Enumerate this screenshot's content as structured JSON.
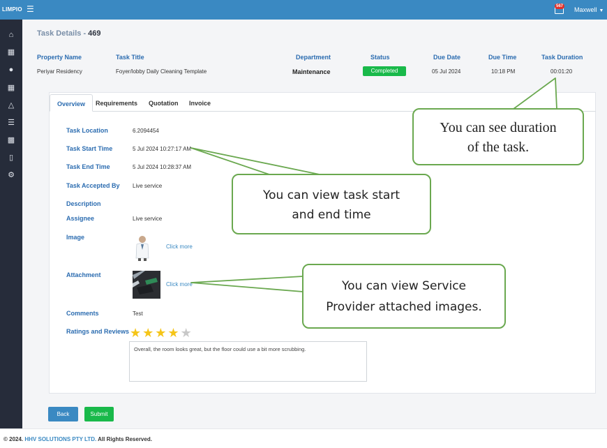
{
  "app": {
    "brand": "LIMPIO",
    "notification_count": "567",
    "user_name": "Maxwell"
  },
  "sidebar": {
    "icons": [
      "home-icon",
      "calendar-icon",
      "user-icon",
      "grid-icon",
      "flask-icon",
      "list-icon",
      "map-icon",
      "document-icon",
      "gear-icon"
    ]
  },
  "page": {
    "title_prefix": "Task Details - ",
    "task_id": "469"
  },
  "summary": {
    "headers": {
      "property": "Property Name",
      "task": "Task Title",
      "department": "Department",
      "status": "Status",
      "due_date": "Due Date",
      "due_time": "Due Time",
      "duration": "Task Duration"
    },
    "values": {
      "property": "Periyar Residency",
      "task": "Foyer/lobby Daily Cleaning Template",
      "department": "Maintenance",
      "status": "Completed",
      "due_date": "05 Jul 2024",
      "due_time": "10:18 PM",
      "duration": "00:01:20"
    },
    "status_color": "#19b94a"
  },
  "tabs": [
    "Overview",
    "Requirements",
    "Quotation",
    "Invoice"
  ],
  "active_tab": "Overview",
  "details": {
    "location_label": "Task Location",
    "location_value": "6.2094454",
    "start_label": "Task Start Time",
    "start_value": "5 Jul 2024 10:27:17 AM",
    "end_label": "Task End Time",
    "end_value": "5 Jul 2024 10:28:37 AM",
    "accepted_label": "Task Accepted By",
    "accepted_value": "Live service",
    "description_label": "Description",
    "assignee_label": "Assignee",
    "assignee_value": "Live service",
    "image_label": "Image",
    "image_link": "Click more",
    "attachment_label": "Attachment",
    "attachment_link": "Click more",
    "comments_label": "Comments",
    "comments_value": "Test",
    "ratings_label": "Ratings and Reviews",
    "rating": 4,
    "rating_max": 5,
    "review_text": "Overall, the room looks great, but the floor could use a bit more scrubbing."
  },
  "buttons": {
    "back": "Back",
    "submit": "Submit"
  },
  "footer": {
    "year": "© 2024.",
    "company": "HHV SOLUTIONS PTY LTD.",
    "rights": "All Rights Reserved."
  },
  "callouts": {
    "duration": [
      "You can see duration",
      "of the task."
    ],
    "time": [
      "You can view task start",
      "and end time"
    ],
    "images": [
      "You can view Service",
      "Provider attached images."
    ]
  },
  "colors": {
    "topbar": "#3a89c2",
    "sidebar": "#262c3a",
    "accent": "#2b6cb0",
    "success": "#19b94a",
    "callout_border": "#6aa84f",
    "star": "#f5c518"
  }
}
